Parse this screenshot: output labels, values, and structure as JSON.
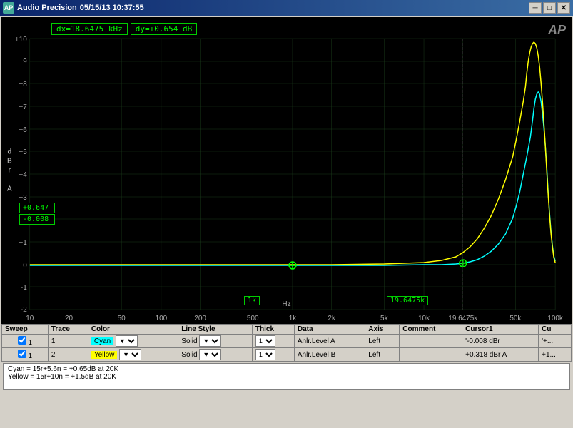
{
  "titleBar": {
    "appName": "Audio Precision",
    "datetime": "05/15/13  10:37:55",
    "minBtn": "─",
    "maxBtn": "□",
    "closeBtn": "✕"
  },
  "cursor": {
    "dx": "dx=18.6475 kHz",
    "dy": "dy=+0.654  dB"
  },
  "apLogo": "AP",
  "yAxis": {
    "label": "d\nB\nr\n\nA"
  },
  "chart": {
    "yGridLabels": [
      "+10",
      "+9",
      "+8",
      "+7",
      "+6",
      "+5",
      "+4",
      "+3",
      "+2",
      "+1",
      "0",
      "-1",
      "-2"
    ],
    "xGridLabels": [
      "10",
      "20",
      "50",
      "100",
      "200",
      "500",
      "1k",
      "2k",
      "5k",
      "10k",
      "19.6475k",
      "50k",
      "100k"
    ],
    "highlightedFreq1": "1k",
    "highlightedFreq2": "19.6475k",
    "valueBox1": "+0.647",
    "valueBox2": "-0.008"
  },
  "table": {
    "headers": [
      "Sweep",
      "Trace",
      "Color",
      "Line Style",
      "Thick",
      "Data",
      "Axis",
      "Comment",
      "Cursor1",
      "Cu"
    ],
    "rows": [
      {
        "checkbox": "x",
        "sweep": "1",
        "trace": "1",
        "color": "Cyan",
        "lineStyle": "Solid",
        "thick": "1",
        "data": "Anlr.Level A",
        "axis": "Left",
        "comment": "",
        "cursor1": "'-0.008  dBr",
        "cu": "'+..."
      },
      {
        "checkbox": "x",
        "sweep": "1",
        "trace": "2",
        "color": "Yellow",
        "lineStyle": "Solid",
        "thick": "1",
        "data": "Anlr.Level B",
        "axis": "Left",
        "comment": "",
        "cursor1": "+0.318  dBr A",
        "cu": "+1..."
      }
    ]
  },
  "notes": {
    "line1": "Cyan = 15r+5.6n = +0.65dB at 20K",
    "line2": "Yellow = 15r+10n = +1.5dB at 20K"
  },
  "hz": "Hz"
}
